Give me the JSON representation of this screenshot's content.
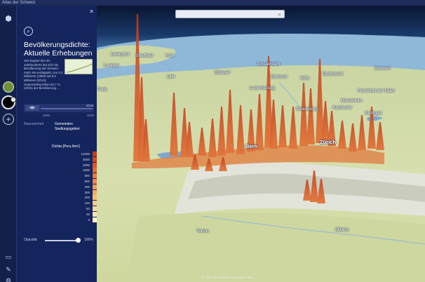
{
  "window": {
    "title": "Atlas der Schweiz"
  },
  "search": {
    "placeholder": ""
  },
  "panel": {
    "title": "Bevölkerungsdichte: Aktuelle Erhebungen",
    "description": "Seit Beginn des 20. Jahrhunderts hat sich die Bevölkerung der Schweiz mehr als verdoppelt: von 3,3 Millionen (1900) auf 8,2 Millionen (2014). Gegenwärtig leben 83,7 % (2015) der Bevölkerung ...",
    "timeline": {
      "start": "2000",
      "end": "2019",
      "current": "2019"
    },
    "unit": {
      "label": "Raumeinheit",
      "options": [
        "Gemeinden",
        "Siedlungsgebiet"
      ]
    },
    "legend_title": "Dichte [Pers./km²]",
    "legend": [
      {
        "value": "12000",
        "color": "#c0401a"
      },
      {
        "value": "3000",
        "color": "#cb4b1f"
      },
      {
        "value": "2000",
        "color": "#d65a27"
      },
      {
        "value": "1000",
        "color": "#df6c33"
      },
      {
        "value": "800",
        "color": "#e57c3e"
      },
      {
        "value": "500",
        "color": "#ea8d4a"
      },
      {
        "value": "400",
        "color": "#ee9e58"
      },
      {
        "value": "300",
        "color": "#f1ae67"
      },
      {
        "value": "200",
        "color": "#f3bd78"
      },
      {
        "value": "100",
        "color": "#f5cb8b"
      },
      {
        "value": "50",
        "color": "#f7d89f"
      },
      {
        "value": "20",
        "color": "#f8e3b3"
      },
      {
        "value": "0",
        "color": "#faedc8"
      }
    ],
    "opacity": {
      "label": "Opacität",
      "value": "100%",
      "fraction": 1.0
    }
  },
  "map": {
    "cities": [
      {
        "name": "Liverpool",
        "big": false
      },
      {
        "name": "Sheffield",
        "big": false
      },
      {
        "name": "Hull",
        "big": false
      },
      {
        "name": "London",
        "big": false
      },
      {
        "name": "Lille",
        "big": false
      },
      {
        "name": "Brüssel",
        "big": false
      },
      {
        "name": "Amsterdam",
        "big": false
      },
      {
        "name": "Bochum",
        "big": false
      },
      {
        "name": "Köln",
        "big": false
      },
      {
        "name": "Dortmund",
        "big": false
      },
      {
        "name": "Bremen",
        "big": false
      },
      {
        "name": "Luxembourg",
        "big": false
      },
      {
        "name": "Frankfurt am Main",
        "big": false
      },
      {
        "name": "Mannheim",
        "big": false
      },
      {
        "name": "Strasbourg",
        "big": false
      },
      {
        "name": "Karlsruhe",
        "big": false
      },
      {
        "name": "Stuttgart",
        "big": false
      },
      {
        "name": "Bern",
        "big": true
      },
      {
        "name": "Zürich",
        "big": true
      },
      {
        "name": "Torino",
        "big": false
      },
      {
        "name": "Milano",
        "big": false
      },
      {
        "name": "Paris",
        "big": false
      }
    ],
    "copyright": "© Atlas der Schweiz, swisstopo, BFS"
  }
}
